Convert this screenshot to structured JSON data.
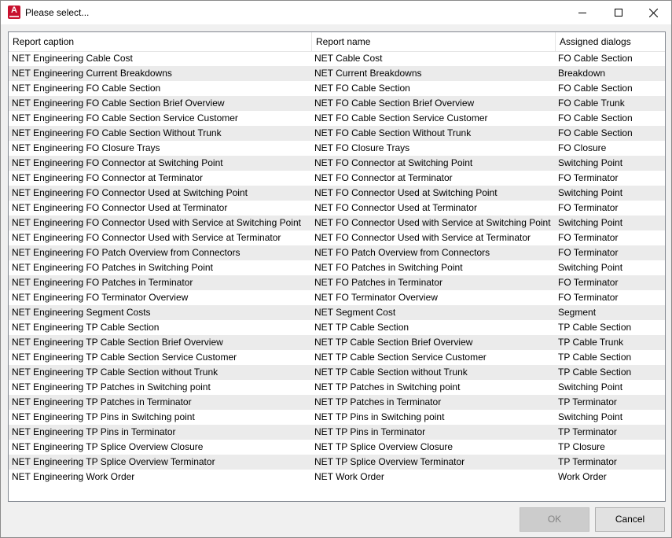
{
  "window": {
    "title": "Please select...",
    "app_icon_letter": "A"
  },
  "table": {
    "columns": [
      "Report caption",
      "Report name",
      "Assigned dialogs"
    ],
    "rows": [
      [
        "NET Engineering Cable Cost",
        "NET Cable Cost",
        "FO Cable Section"
      ],
      [
        "NET Engineering Current Breakdowns",
        "NET Current Breakdowns",
        "Breakdown"
      ],
      [
        "NET Engineering FO Cable Section",
        "NET FO Cable Section",
        "FO Cable Section"
      ],
      [
        "NET Engineering FO Cable Section Brief Overview",
        "NET FO Cable Section Brief Overview",
        "FO Cable Trunk"
      ],
      [
        "NET Engineering FO Cable Section Service Customer",
        "NET FO Cable Section Service Customer",
        "FO Cable Section"
      ],
      [
        "NET Engineering FO Cable Section Without Trunk",
        "NET FO Cable Section Without Trunk",
        "FO Cable Section"
      ],
      [
        "NET Engineering FO Closure Trays",
        "NET FO Closure Trays",
        "FO Closure"
      ],
      [
        "NET Engineering FO Connector at Switching Point",
        "NET FO Connector at Switching Point",
        "Switching Point"
      ],
      [
        "NET Engineering FO Connector at Terminator",
        "NET FO Connector at Terminator",
        "FO Terminator"
      ],
      [
        "NET Engineering FO Connector Used at Switching Point",
        "NET FO Connector Used at Switching Point",
        "Switching Point"
      ],
      [
        "NET Engineering FO Connector Used at Terminator",
        "NET FO Connector Used at Terminator",
        "FO Terminator"
      ],
      [
        "NET Engineering FO Connector Used with Service at Switching Point",
        "NET FO Connector Used with Service at Switching Point",
        "Switching Point"
      ],
      [
        "NET Engineering FO Connector Used with Service at Terminator",
        "NET FO Connector Used with Service at Terminator",
        "FO Terminator"
      ],
      [
        "NET Engineering FO Patch Overview from Connectors",
        "NET FO Patch Overview from Connectors",
        "FO Terminator"
      ],
      [
        "NET Engineering FO Patches in Switching Point",
        "NET FO Patches in Switching Point",
        "Switching Point"
      ],
      [
        "NET Engineering FO Patches in Terminator",
        "NET FO Patches in Terminator",
        "FO Terminator"
      ],
      [
        "NET Engineering FO Terminator Overview",
        "NET FO Terminator Overview",
        "FO Terminator"
      ],
      [
        "NET Engineering Segment Costs",
        "NET Segment Cost",
        "Segment"
      ],
      [
        "NET Engineering TP Cable Section",
        "NET TP Cable Section",
        "TP Cable Section"
      ],
      [
        "NET Engineering TP Cable Section Brief Overview",
        "NET TP Cable Section Brief Overview",
        "TP Cable Trunk"
      ],
      [
        "NET Engineering TP Cable Section Service Customer",
        "NET TP Cable Section Service Customer",
        "TP Cable Section"
      ],
      [
        "NET Engineering TP Cable Section without Trunk",
        "NET TP Cable Section without Trunk",
        "TP Cable Section"
      ],
      [
        "NET Engineering TP Patches in Switching point",
        "NET TP Patches in Switching point",
        "Switching Point"
      ],
      [
        "NET Engineering TP Patches in Terminator",
        "NET TP Patches in Terminator",
        "TP Terminator"
      ],
      [
        "NET Engineering TP Pins in Switching point",
        "NET TP Pins in Switching point",
        "Switching Point"
      ],
      [
        "NET Engineering TP Pins in Terminator",
        "NET TP Pins in Terminator",
        "TP Terminator"
      ],
      [
        "NET Engineering TP Splice Overview Closure",
        "NET TP Splice Overview Closure",
        "TP Closure"
      ],
      [
        "NET Engineering TP Splice Overview Terminator",
        "NET TP Splice Overview Terminator",
        "TP Terminator"
      ],
      [
        "NET Engineering Work Order",
        "NET Work Order",
        "Work Order"
      ]
    ]
  },
  "buttons": {
    "ok": "OK",
    "cancel": "Cancel"
  },
  "colors": {
    "app_icon": "#c8102e",
    "alt_row": "#ebebeb",
    "disabled_button": "#cccccc"
  },
  "icons": {
    "app": "app-logo-icon",
    "minimize": "minimize-icon",
    "maximize": "maximize-icon",
    "close": "close-icon"
  }
}
